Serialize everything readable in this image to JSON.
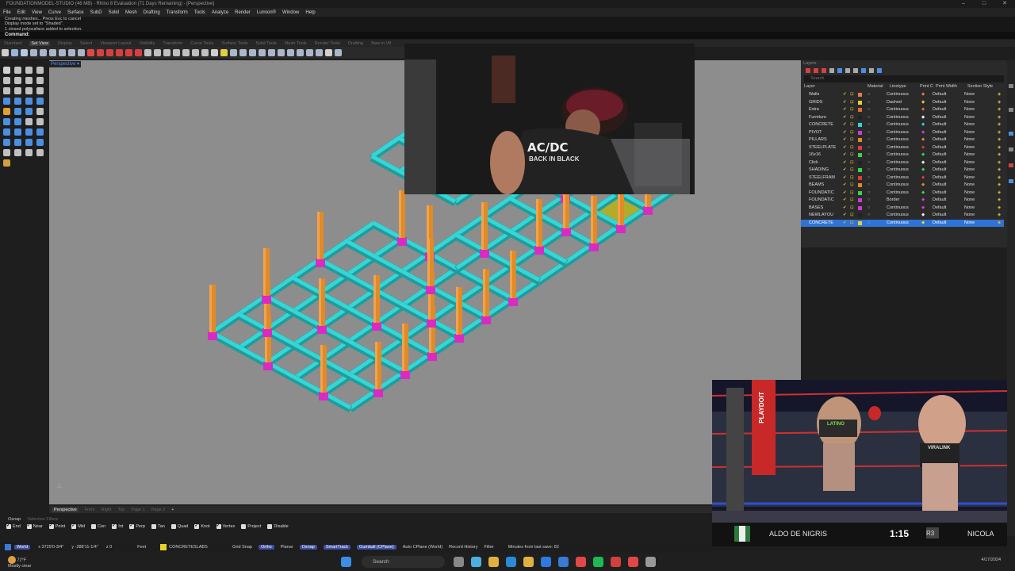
{
  "window": {
    "title": "FOUNDATIONMODEL-STUDIO (46 MB) - Rhino 8 Evaluation (71 Days Remaining) - [Perspective]",
    "controls": [
      "–",
      "□",
      "✕"
    ]
  },
  "menu": [
    "File",
    "Edit",
    "View",
    "Curve",
    "Surface",
    "SubD",
    "Solid",
    "Mesh",
    "Drafting",
    "Transform",
    "Tools",
    "Analyze",
    "Render",
    "Lumion®",
    "Window",
    "Help"
  ],
  "command_history": [
    "Creating meshes... Press Esc to cancel",
    "Display mode set to \"Shaded\".",
    "1 closed polysurface added to selection."
  ],
  "command_prompt": "Command:",
  "toolbar_tabs": [
    "Standard",
    "Set View",
    "Display",
    "Select",
    "Viewport Layout",
    "Visibility",
    "Transform",
    "Curve Tools",
    "Surface Tools",
    "Solid Tools",
    "Mesh Tools",
    "Render Tools",
    "Drafting",
    "New in V8"
  ],
  "active_toolbar_tab": "Set View",
  "viewport": {
    "label": "Perspective",
    "label_arrow": "▾"
  },
  "layers_panel": {
    "title": "Layers",
    "search_placeholder": "Search",
    "columns": [
      "Layer",
      "Material",
      "Linetype",
      "Print C",
      "Print Width",
      "Section Style"
    ],
    "rows": [
      {
        "name": "Walls",
        "color": "#e8775a",
        "linetype": "Continuous",
        "printcolor": "#e8775a",
        "printwidth": "Default",
        "section": "None"
      },
      {
        "name": "GRIDS",
        "color": "#e8d02c",
        "linetype": "Dashed",
        "printcolor": "#e8d02c",
        "printwidth": "Default",
        "section": "None"
      },
      {
        "name": "Extra",
        "color": "#e06a3a",
        "linetype": "Continuous",
        "printcolor": "#e06a3a",
        "printwidth": "Default",
        "section": "None"
      },
      {
        "name": "Furniture",
        "color": "#222222",
        "linetype": "Continuous",
        "printcolor": "#222222",
        "printwidth": "Default",
        "section": "None"
      },
      {
        "name": "CONCRETE",
        "color": "#2ad8e0",
        "linetype": "Continuous",
        "printcolor": "#2ad8e0",
        "printwidth": "Default",
        "section": "None"
      },
      {
        "name": "PIVOT",
        "color": "#d23ad6",
        "linetype": "Continuous",
        "printcolor": "#d23ad6",
        "printwidth": "Default",
        "section": "None"
      },
      {
        "name": "PILLARS",
        "color": "#e38a28",
        "linetype": "Continuous",
        "printcolor": "#e38a28",
        "printwidth": "Default",
        "section": "None"
      },
      {
        "name": "STEELPLATE",
        "color": "#e03a3a",
        "linetype": "Continuous",
        "printcolor": "#e03a3a",
        "printwidth": "Default",
        "section": "None"
      },
      {
        "name": "16x16",
        "color": "#38d64a",
        "linetype": "Continuous",
        "printcolor": "#38d64a",
        "printwidth": "Default",
        "section": "None"
      },
      {
        "name": "Click",
        "color": "#222222",
        "linetype": "Continuous",
        "printcolor": "#222222",
        "printwidth": "Default",
        "section": "None"
      },
      {
        "name": "SHADING",
        "color": "#38d64a",
        "linetype": "Continuous",
        "printcolor": "#38d64a",
        "printwidth": "Default",
        "section": "None"
      },
      {
        "name": "STEELFRAM",
        "color": "#e03a3a",
        "linetype": "Continuous",
        "printcolor": "#e03a3a",
        "printwidth": "Default",
        "section": "None"
      },
      {
        "name": "BEAMS",
        "color": "#e38a28",
        "linetype": "Continuous",
        "printcolor": "#e38a28",
        "printwidth": "Default",
        "section": "None"
      },
      {
        "name": "FOUNDATIC",
        "color": "#38d64a",
        "linetype": "Continuous",
        "printcolor": "#38d64a",
        "printwidth": "Default",
        "section": "None"
      },
      {
        "name": "FOUNDATIC",
        "color": "#d23ad6",
        "linetype": "Border",
        "printcolor": "#d23ad6",
        "printwidth": "Default",
        "section": "None"
      },
      {
        "name": "BASES",
        "color": "#d23ad6",
        "linetype": "Continuous",
        "printcolor": "#d23ad6",
        "printwidth": "Default",
        "section": "None"
      },
      {
        "name": "NEWLAYOU",
        "color": "#222222",
        "linetype": "Continuous",
        "printcolor": "#222222",
        "printwidth": "Default",
        "section": "None"
      },
      {
        "name": "CONCRETE",
        "color": "#e8d02c",
        "linetype": "Continuous",
        "printcolor": "#e8d02c",
        "printwidth": "Default",
        "section": "None",
        "selected": true
      }
    ]
  },
  "viewport_tabs": [
    "Perspective",
    "Front",
    "Right",
    "Top",
    "Page 1",
    "Page 2",
    "+"
  ],
  "active_viewport_tab": "Perspective",
  "osnap_header": [
    "Osnap",
    "Selection Filters"
  ],
  "osnaps": [
    {
      "label": "End",
      "on": true
    },
    {
      "label": "Near",
      "on": true
    },
    {
      "label": "Point",
      "on": true
    },
    {
      "label": "Mid",
      "on": true
    },
    {
      "label": "Cen",
      "on": false
    },
    {
      "label": "Int",
      "on": true
    },
    {
      "label": "Perp",
      "on": true
    },
    {
      "label": "Tan",
      "on": false
    },
    {
      "label": "Quad",
      "on": false
    },
    {
      "label": "Knot",
      "on": true
    },
    {
      "label": "Vertex",
      "on": true
    },
    {
      "label": "Project",
      "on": false
    },
    {
      "label": "Disable",
      "on": false
    }
  ],
  "statusbar": {
    "cplane": "World",
    "x": "x 3729'0-3/4\"",
    "y": "y -288'11-1/4\"",
    "z": "z 0",
    "units": "Feet",
    "layer": "CONCRETESLABS",
    "layer_color": "#e8d02c",
    "toggles": [
      {
        "label": "Grid Snap",
        "on": false
      },
      {
        "label": "Ortho",
        "on": true
      },
      {
        "label": "Planar",
        "on": false
      },
      {
        "label": "Osnap",
        "on": true
      },
      {
        "label": "SmartTrack",
        "on": true
      },
      {
        "label": "Gumball (CPlane)",
        "on": true
      },
      {
        "label": "Auto CPlane (World)",
        "on": false
      },
      {
        "label": "Record History",
        "on": false
      },
      {
        "label": "Filter",
        "on": false
      }
    ],
    "minutes": "Minutes from last save: 82"
  },
  "webcam": {
    "shirt_line1": "AC/DC",
    "shirt_line2": "BACK IN BLACK"
  },
  "sports": {
    "boxer1": "ALDO DE NIGRIS",
    "boxer2": "NICOLA",
    "clock": "1:15",
    "brand": "PLAYDOIT",
    "trunks1": "LATINO",
    "trunks2": "VIRALINK",
    "round_badge": "R3"
  },
  "taskbar": {
    "weather_temp": "72°F",
    "weather_desc": "Mostly clear",
    "search": "Search",
    "date": "4/17/2024"
  },
  "colors": {
    "beam": "#34d6d6",
    "pillar": "#e08a28",
    "base": "#d82bc4",
    "slab": "#b9b21c",
    "viewport": "#8d8d8d",
    "selection": "#2f73d6"
  }
}
